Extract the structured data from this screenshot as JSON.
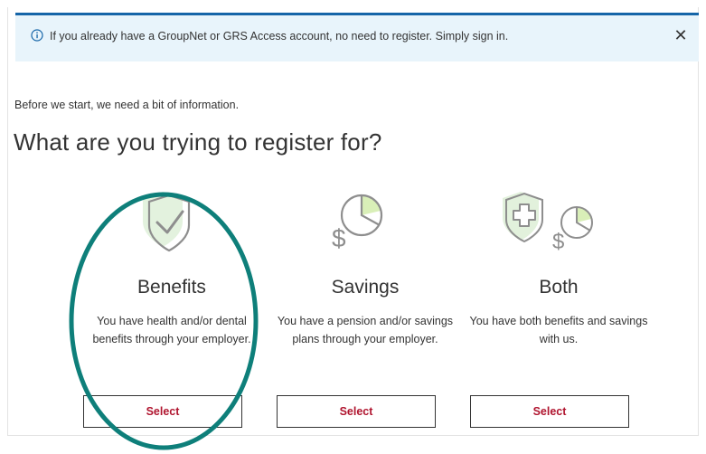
{
  "banner": {
    "info_icon": "info-circle-icon",
    "message": "If you already have a GroupNet or GRS Access account, no need to register. Simply sign in.",
    "close_label": "✕"
  },
  "intro_text": "Before we start, we need a bit of information.",
  "heading": "What are you trying to register for?",
  "options": [
    {
      "icon": "shield-check-icon",
      "title": "Benefits",
      "description": "You have health and/or dental benefits through your employer.",
      "button_label": "Select"
    },
    {
      "icon": "dollar-pie-icon",
      "title": "Savings",
      "description": "You have a pension and/or savings plans through your employer.",
      "button_label": "Select"
    },
    {
      "icon": "shield-cross-dollar-pie-icon",
      "title": "Both",
      "description": "You have both benefits and savings with us.",
      "button_label": "Select"
    }
  ],
  "colors": {
    "banner_bg": "#e8f4fb",
    "banner_border": "#1565a8",
    "select_text": "#b0152f",
    "highlight_ring": "#0e7f7a",
    "icon_accent": "#d9efb8"
  }
}
